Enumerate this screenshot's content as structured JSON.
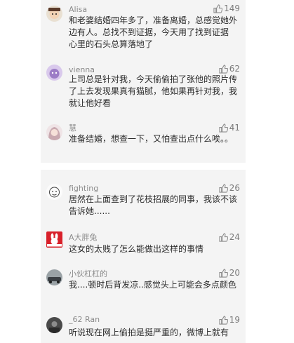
{
  "colors": {
    "card_bg": "#f4f4f4",
    "username": "#8a8a8a",
    "text": "#2b2b2b",
    "likes": "#7a7a7a"
  },
  "comments": [
    {
      "username": "Alisa",
      "likes": "149",
      "text": "和老婆结婚四年多了，准备离婚，总感觉她外边有人。总找不到证据，今天用了找到证据 心里的石头总算落地了",
      "avatar_icon": "cartoon-face-avatar-icon"
    },
    {
      "username": "vienna",
      "likes": "62",
      "text": "上司总是针对我，今天偷偷拍了张他的照片传了上去发现果真有猫腻，他如果再针对我，我就让他好看",
      "avatar_icon": "purple-cartoon-avatar-icon"
    },
    {
      "username": "慧",
      "likes": "41",
      "text": "准备结婚，想查一下，又怕查出点什么唉。。",
      "avatar_icon": "anime-girl-avatar-icon"
    },
    {
      "username": "fighting",
      "likes": "26",
      "text": "居然在上面查到了花枝招展的同事，我该不该告诉她......",
      "avatar_icon": "sketch-face-avatar-icon"
    },
    {
      "username": "A大胖兔",
      "likes": "24",
      "text": "这女的太贱了怎么能做出这样的事情",
      "avatar_icon": "red-rabbit-logo-avatar-icon"
    },
    {
      "username": "小伙杠杠的",
      "likes": "20",
      "text": "我....顿时后背发凉..感觉头上可能会多点颜色",
      "avatar_icon": "car-photo-avatar-icon"
    },
    {
      "username": "_62 Ran",
      "likes": "19",
      "text": "听说现在网上偷拍是挺严重的，微博上就有",
      "avatar_icon": "dark-photo-avatar-icon"
    }
  ]
}
